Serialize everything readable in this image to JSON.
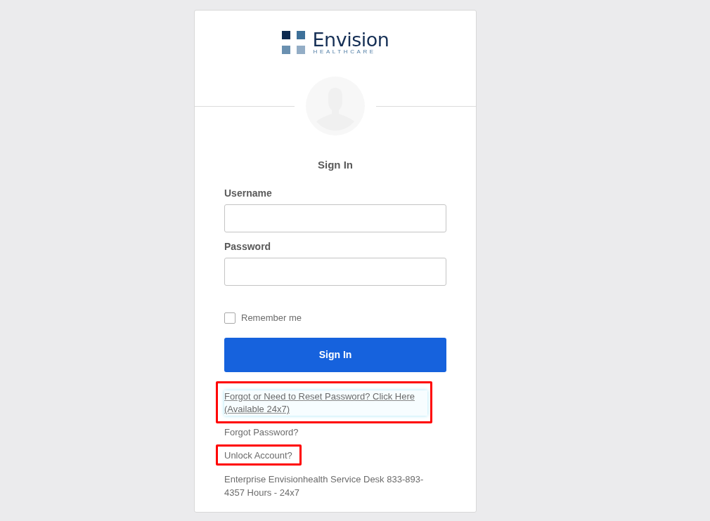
{
  "logo": {
    "name": "Envision",
    "tagline": "HEALTHCARE"
  },
  "heading": "Sign In",
  "fields": [
    {
      "label": "Username"
    },
    {
      "label": "Password"
    }
  ],
  "remember_me": {
    "label": "Remember me",
    "checked": false
  },
  "submit": "Sign In",
  "links": [
    {
      "text": "Forgot or Need to Reset Password? Click Here (Available 24x7)",
      "underlined": true,
      "focused": true,
      "highlighted": true
    },
    {
      "text": "Forgot Password?",
      "underlined": false,
      "focused": false,
      "highlighted": false
    },
    {
      "text": "Unlock Account?",
      "underlined": false,
      "focused": false,
      "highlighted": true
    }
  ],
  "help_text": "Enterprise Envisionhealth Service Desk 833-893-4357 Hours - 24x7"
}
